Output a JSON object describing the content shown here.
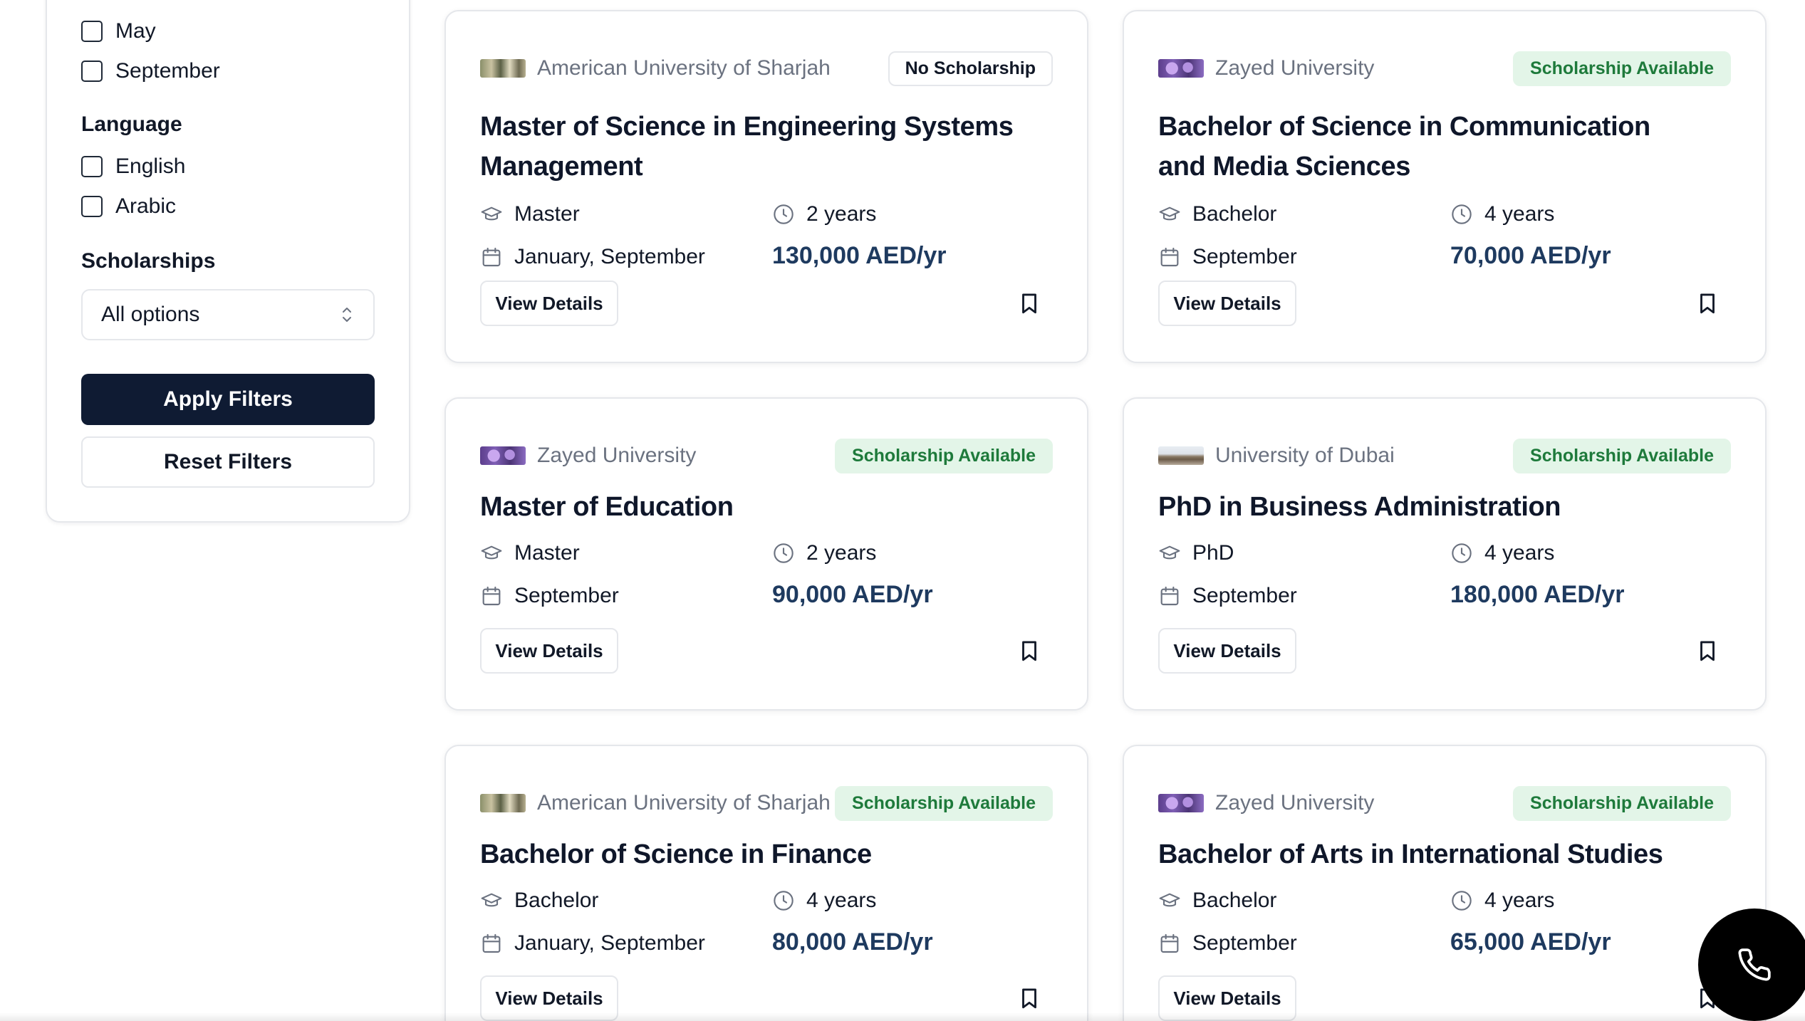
{
  "filters": {
    "intake_options": [
      "May",
      "September"
    ],
    "language": {
      "title": "Language",
      "options": [
        "English",
        "Arabic"
      ]
    },
    "scholarships": {
      "title": "Scholarships",
      "selected": "All options"
    },
    "apply_label": "Apply Filters",
    "reset_label": "Reset Filters"
  },
  "programs": [
    {
      "university": "American University of Sharjah",
      "badge": "No Scholarship",
      "title": "Master of Science in Engineering Systems Management",
      "level": "Master",
      "duration": "2 years",
      "intakes": "January, September",
      "tuition": "130,000 AED/yr",
      "view_label": "View Details"
    },
    {
      "university": "Zayed University",
      "badge": "Scholarship Available",
      "title": "Bachelor of Science in Communication and Media Sciences",
      "level": "Bachelor",
      "duration": "4 years",
      "intakes": "September",
      "tuition": "70,000 AED/yr",
      "view_label": "View Details"
    },
    {
      "university": "Zayed University",
      "badge": "Scholarship Available",
      "title": "Master of Education",
      "level": "Master",
      "duration": "2 years",
      "intakes": "September",
      "tuition": "90,000 AED/yr",
      "view_label": "View Details"
    },
    {
      "university": "University of Dubai",
      "badge": "Scholarship Available",
      "title": "PhD in Business Administration",
      "level": "PhD",
      "duration": "4 years",
      "intakes": "September",
      "tuition": "180,000 AED/yr",
      "view_label": "View Details"
    },
    {
      "university": "American University of Sharjah",
      "badge": "Scholarship Available",
      "title": "Bachelor of Science in Finance",
      "level": "Bachelor",
      "duration": "4 years",
      "intakes": "January, September",
      "tuition": "80,000 AED/yr",
      "view_label": "View Details"
    },
    {
      "university": "Zayed University",
      "badge": "Scholarship Available",
      "title": "Bachelor of Arts in International Studies",
      "level": "Bachelor",
      "duration": "4 years",
      "intakes": "September",
      "tuition": "65,000 AED/yr",
      "view_label": "View Details"
    }
  ],
  "icons": {
    "level": "graduation-cap-icon",
    "duration": "clock-icon",
    "intake": "calendar-icon",
    "save": "bookmark-icon",
    "call": "phone-icon",
    "select": "chevrons-up-down-icon"
  },
  "colors": {
    "primary_button": "#0f1b33",
    "scholarship_badge_bg": "#e3f5e8",
    "scholarship_badge_text": "#1e7a3b",
    "price_text": "#1e3a5f"
  }
}
